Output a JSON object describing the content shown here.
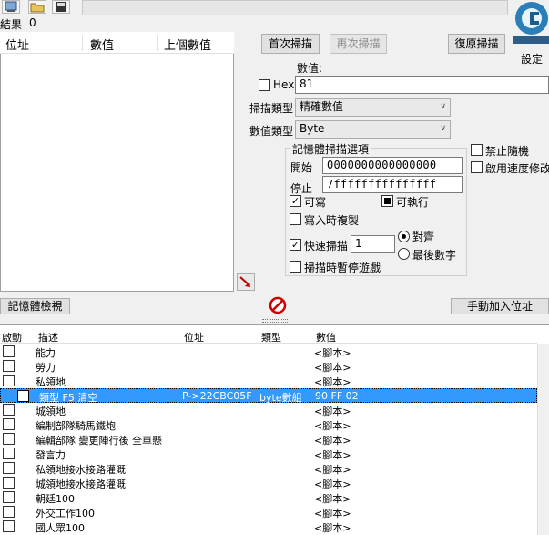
{
  "results": {
    "label": "結果",
    "count": "0"
  },
  "found_list": {
    "columns": [
      "位址",
      "數值",
      "上個數值"
    ]
  },
  "buttons": {
    "first_scan": "首次掃描",
    "next_scan": "再次掃描",
    "undo_scan": "復原掃描",
    "settings": "設定",
    "memory_view": "記憶體檢視",
    "add_address": "手動加入位址"
  },
  "value": {
    "label": "數值:",
    "hex_label": "Hex",
    "input": "81"
  },
  "scan_type": {
    "label": "掃描類型",
    "selected": "精確數值"
  },
  "value_type": {
    "label": "數值類型",
    "selected": "Byte"
  },
  "mem_options": {
    "title": "記憶體掃描選項",
    "start_label": "開始",
    "start_value": "0000000000000000",
    "stop_label": "停止",
    "stop_value": "7fffffffffffffff",
    "writable": "可寫",
    "executable": "可執行",
    "copy_on_write": "寫入時複製",
    "fast_scan": "快速掃描",
    "fast_scan_value": "1",
    "alignment": "對齊",
    "last_digits": "最後數字",
    "pause_game": "掃描時暫停遊戲"
  },
  "side_options": {
    "unrandomizer": "禁止隨機",
    "speedhack": "啟用速度修改"
  },
  "table": {
    "columns": [
      "啟動",
      "描述",
      "位址",
      "類型",
      "數值"
    ],
    "rows": [
      {
        "desc": "能力",
        "addr": "",
        "type": "",
        "value": "<腳本>"
      },
      {
        "desc": "勞力",
        "addr": "",
        "type": "",
        "value": "<腳本>"
      },
      {
        "desc": "私領地",
        "addr": "",
        "type": "",
        "value": "<腳本>"
      },
      {
        "desc": "類型 F5 清空",
        "addr": "P->22CBC05F",
        "type": "byte數組",
        "value": "90 FF 02"
      },
      {
        "desc": "城領地",
        "addr": "",
        "type": "",
        "value": "<腳本>"
      },
      {
        "desc": "編制部隊騎馬鐵炮",
        "addr": "",
        "type": "",
        "value": "<腳本>"
      },
      {
        "desc": "編輯部隊 變更陣行後 全車懸",
        "addr": "",
        "type": "",
        "value": "<腳本>"
      },
      {
        "desc": "發言力",
        "addr": "",
        "type": "",
        "value": "<腳本>"
      },
      {
        "desc": "私領地接水接路灌溉",
        "addr": "",
        "type": "",
        "value": "<腳本>"
      },
      {
        "desc": "城領地接水接路灌溉",
        "addr": "",
        "type": "",
        "value": "<腳本>"
      },
      {
        "desc": "朝廷100",
        "addr": "",
        "type": "",
        "value": "<腳本>"
      },
      {
        "desc": "外交工作100",
        "addr": "",
        "type": "",
        "value": "<腳本>"
      },
      {
        "desc": "國人眾100",
        "addr": "",
        "type": "",
        "value": "<腳本>"
      }
    ]
  },
  "colors": {
    "selection": "#3399ff",
    "list_bg": "#ffffff",
    "window_bg": "#f0f0f0",
    "stop_icon": "#cc0000"
  },
  "icons": [
    "process-icon",
    "open-icon",
    "save-icon",
    "pointer-arrow-icon",
    "stop-icon",
    "cheat-engine-logo"
  ]
}
